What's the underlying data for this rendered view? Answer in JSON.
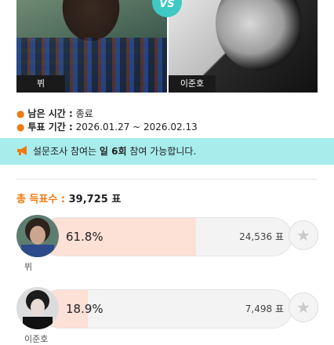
{
  "matchup": {
    "vs_label": "VS",
    "left": {
      "name": "뷔"
    },
    "right": {
      "name": "이준호"
    }
  },
  "info": {
    "remaining_label": "남은 시간 :",
    "remaining_value": "종료",
    "period_label": "투표 기간 :",
    "period_value": "2026.01.27 ~ 2026.02.13"
  },
  "notice": {
    "icon": "megaphone-icon",
    "text_before": "설문조사 참여는 ",
    "text_bold": "일 6회",
    "text_after": " 참여 가능합니다."
  },
  "total": {
    "label": "총 득표수 :",
    "value": "39,725 표"
  },
  "results": [
    {
      "name": "뷔",
      "percent_label": "61.8%",
      "percent": 61.8,
      "votes": "24,536 표"
    },
    {
      "name": "이준호",
      "percent_label": "18.9%",
      "percent": 18.9,
      "votes": "7,498 표"
    }
  ],
  "colors": {
    "accent": "#f07a12",
    "notice_bg": "#a8ecec",
    "vs_badge": "#40c9c4",
    "bar_fill": "#fde0d6"
  }
}
